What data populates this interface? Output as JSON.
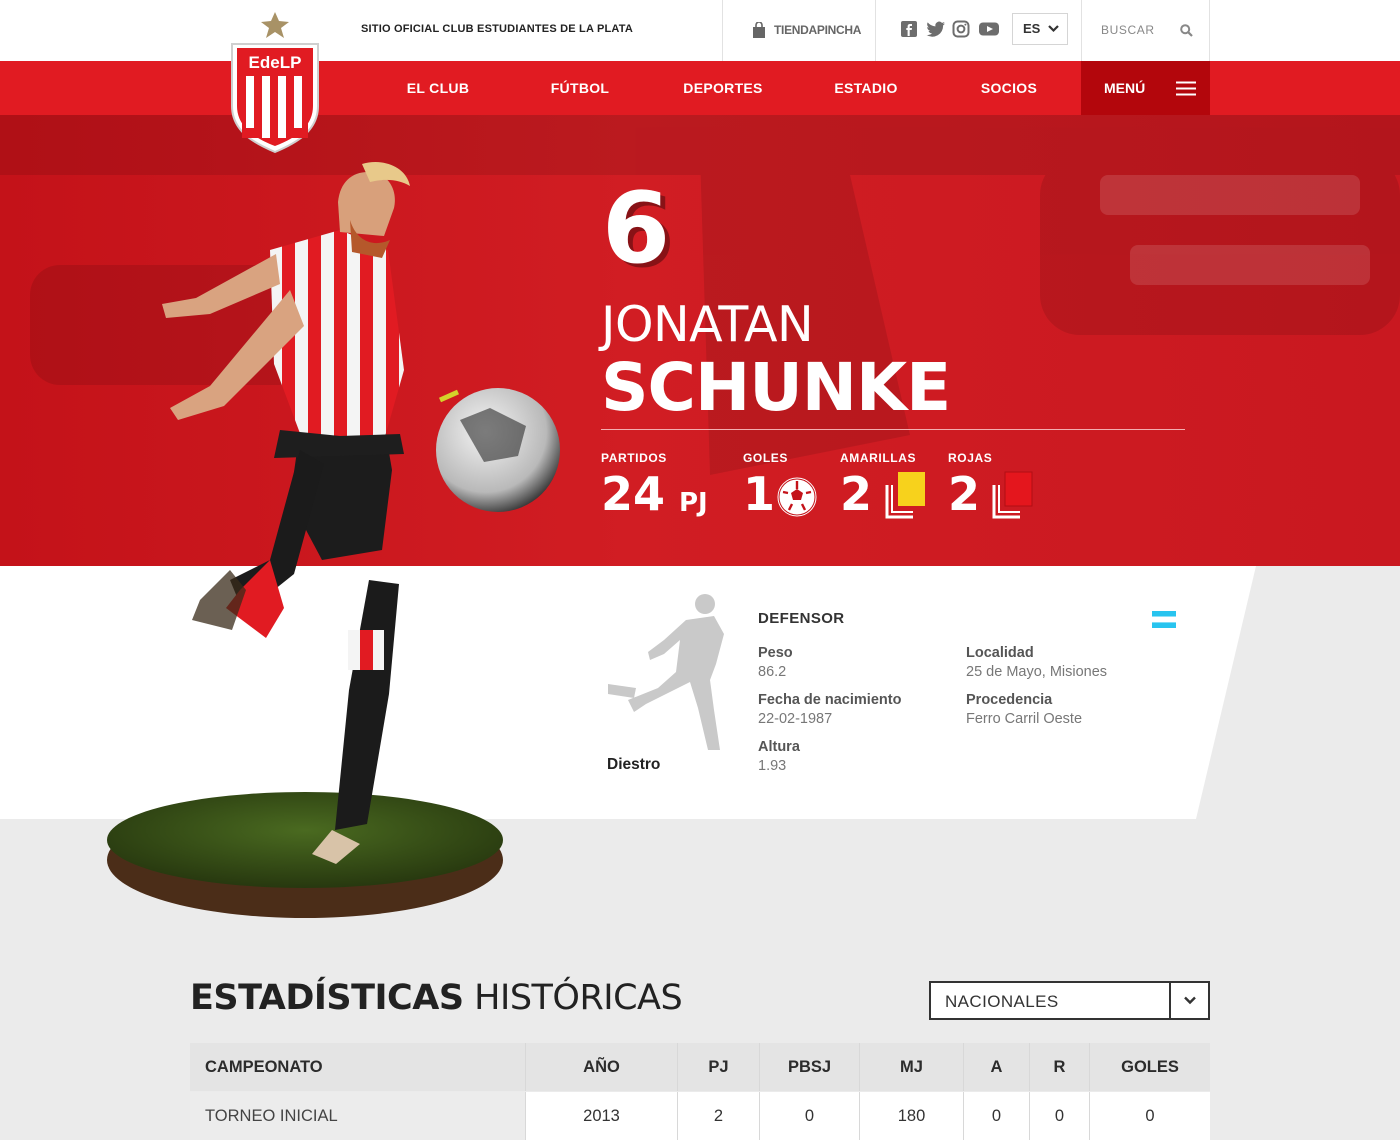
{
  "topbar": {
    "site_label": "SITIO OFICIAL CLUB ESTUDIANTES DE LA PLATA",
    "shop_label": "TIENDAPINCHA",
    "social_icons": [
      "facebook-icon",
      "twitter-icon",
      "instagram-icon",
      "youtube-icon"
    ],
    "language": "ES",
    "search_label": "BUSCAR"
  },
  "logo": {
    "text": "EdeLP"
  },
  "nav": {
    "items": [
      "EL CLUB",
      "FÚTBOL",
      "DEPORTES",
      "ESTADIO",
      "SOCIOS"
    ],
    "menu_label": "MENÚ"
  },
  "player": {
    "number": "6",
    "first_name": "JONATAN",
    "last_name": "SCHUNKE",
    "stats": {
      "partidos_label": "PARTIDOS",
      "partidos_value": "24",
      "partidos_unit": "PJ",
      "goles_label": "GOLES",
      "goles_value": "1",
      "amarillas_label": "AMARILLAS",
      "amarillas_value": "2",
      "rojas_label": "ROJAS",
      "rojas_value": "2"
    },
    "position": "DEFENSOR",
    "foot": "Diestro",
    "details": {
      "peso_label": "Peso",
      "peso_value": "86.2",
      "nacimiento_label": "Fecha de nacimiento",
      "nacimiento_value": "22-02-1987",
      "altura_label": "Altura",
      "altura_value": "1.93",
      "localidad_label": "Localidad",
      "localidad_value": "25 de Mayo, Misiones",
      "procedencia_label": "Procedencia",
      "procedencia_value": "Ferro Carril Oeste"
    }
  },
  "history": {
    "title_bold": "ESTADÍSTICAS",
    "title_light": "HISTÓRICAS",
    "filter_value": "NACIONALES",
    "columns": [
      "CAMPEONATO",
      "AÑO",
      "PJ",
      "PBSJ",
      "MJ",
      "A",
      "R",
      "GOLES"
    ],
    "rows": [
      [
        "TORNEO INICIAL",
        "2013",
        "2",
        "0",
        "180",
        "0",
        "0",
        "0"
      ]
    ]
  },
  "colors": {
    "brand_red": "#e11b22",
    "dark_red": "#b3060c",
    "card_yellow": "#f7d21c",
    "card_red": "#e4161d",
    "flag_blue": "#28c4ef"
  }
}
